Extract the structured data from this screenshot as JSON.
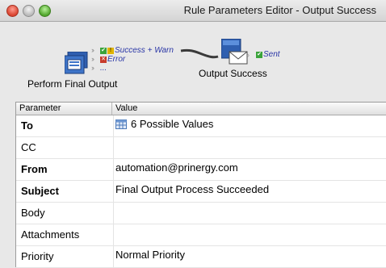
{
  "window": {
    "title": "Rule Parameters Editor - Output Success",
    "controls": [
      "close-icon",
      "minimize-icon",
      "zoom-icon"
    ]
  },
  "diagram": {
    "source_node": {
      "label": "Perform Final Output",
      "icon": "output-process-icon"
    },
    "outputs": [
      {
        "label": "Success + Warn",
        "icons": [
          "check-icon",
          "warning-icon"
        ]
      },
      {
        "label": "Error",
        "icons": [
          "error-icon"
        ]
      },
      {
        "label": "...",
        "icons": []
      }
    ],
    "target_node": {
      "label": "Output Success",
      "icon": "email-icon"
    },
    "target_output": {
      "label": "Sent",
      "icon": "check-icon"
    }
  },
  "table": {
    "headers": {
      "parameter": "Parameter",
      "value": "Value"
    },
    "rows": [
      {
        "parameter": "To",
        "value": "6 Possible Values",
        "bold": true,
        "icon": "list-grid-icon"
      },
      {
        "parameter": "CC",
        "value": "",
        "bold": false
      },
      {
        "parameter": "From",
        "value": "automation@prinergy.com",
        "bold": true
      },
      {
        "parameter": "Subject",
        "value": "Final Output Process Succeeded",
        "bold": true
      },
      {
        "parameter": "Body",
        "value": "",
        "bold": false
      },
      {
        "parameter": "Attachments",
        "value": "",
        "bold": false
      },
      {
        "parameter": "Priority",
        "value": "Normal Priority",
        "bold": false
      }
    ]
  },
  "colors": {
    "output_link": "#2a36a6",
    "check": "#3aa33a",
    "error": "#c73a2a",
    "warning": "#e0b400"
  }
}
